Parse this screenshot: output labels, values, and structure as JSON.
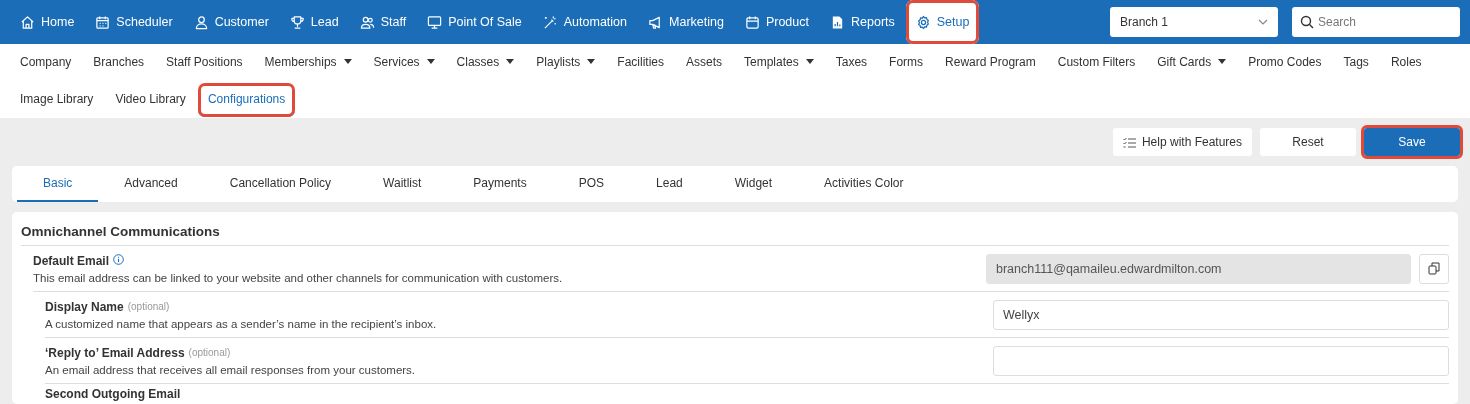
{
  "top_nav": [
    {
      "label": "Home",
      "selected": false,
      "highlighted": false
    },
    {
      "label": "Scheduler",
      "selected": false,
      "highlighted": false
    },
    {
      "label": "Customer",
      "selected": false,
      "highlighted": false
    },
    {
      "label": "Lead",
      "selected": false,
      "highlighted": false
    },
    {
      "label": "Staff",
      "selected": false,
      "highlighted": false
    },
    {
      "label": "Point Of Sale",
      "selected": false,
      "highlighted": false
    },
    {
      "label": "Automation",
      "selected": false,
      "highlighted": false
    },
    {
      "label": "Marketing",
      "selected": false,
      "highlighted": false
    },
    {
      "label": "Product",
      "selected": false,
      "highlighted": false
    },
    {
      "label": "Reports",
      "selected": false,
      "highlighted": false
    },
    {
      "label": "Setup",
      "selected": true,
      "highlighted": true
    }
  ],
  "branch_select": {
    "value": "Branch 1"
  },
  "search": {
    "placeholder": "Search"
  },
  "sub_nav": [
    [
      {
        "label": "Company",
        "dropdown": false,
        "selected": false,
        "highlighted": false
      },
      {
        "label": "Branches",
        "dropdown": false,
        "selected": false,
        "highlighted": false
      },
      {
        "label": "Staff Positions",
        "dropdown": false,
        "selected": false,
        "highlighted": false
      },
      {
        "label": "Memberships",
        "dropdown": true,
        "selected": false,
        "highlighted": false
      },
      {
        "label": "Services",
        "dropdown": true,
        "selected": false,
        "highlighted": false
      },
      {
        "label": "Classes",
        "dropdown": true,
        "selected": false,
        "highlighted": false
      },
      {
        "label": "Playlists",
        "dropdown": true,
        "selected": false,
        "highlighted": false
      },
      {
        "label": "Facilities",
        "dropdown": false,
        "selected": false,
        "highlighted": false
      },
      {
        "label": "Assets",
        "dropdown": false,
        "selected": false,
        "highlighted": false
      },
      {
        "label": "Templates",
        "dropdown": true,
        "selected": false,
        "highlighted": false
      },
      {
        "label": "Taxes",
        "dropdown": false,
        "selected": false,
        "highlighted": false
      },
      {
        "label": "Forms",
        "dropdown": false,
        "selected": false,
        "highlighted": false
      },
      {
        "label": "Reward Program",
        "dropdown": false,
        "selected": false,
        "highlighted": false
      },
      {
        "label": "Custom Filters",
        "dropdown": false,
        "selected": false,
        "highlighted": false
      },
      {
        "label": "Gift Cards",
        "dropdown": true,
        "selected": false,
        "highlighted": false
      },
      {
        "label": "Promo Codes",
        "dropdown": false,
        "selected": false,
        "highlighted": false
      },
      {
        "label": "Tags",
        "dropdown": false,
        "selected": false,
        "highlighted": false
      },
      {
        "label": "Roles",
        "dropdown": false,
        "selected": false,
        "highlighted": false
      }
    ],
    [
      {
        "label": "Image Library",
        "dropdown": false,
        "selected": false,
        "highlighted": false
      },
      {
        "label": "Video Library",
        "dropdown": false,
        "selected": false,
        "highlighted": false
      },
      {
        "label": "Configurations",
        "dropdown": false,
        "selected": true,
        "highlighted": true
      }
    ]
  ],
  "actions": [
    {
      "label": "Help with Features",
      "kind": "help",
      "highlighted": false
    },
    {
      "label": "Reset",
      "kind": "plain",
      "highlighted": false
    },
    {
      "label": "Save",
      "kind": "primary",
      "highlighted": true
    }
  ],
  "tabs": [
    {
      "label": "Basic",
      "selected": true
    },
    {
      "label": "Advanced",
      "selected": false
    },
    {
      "label": "Cancellation Policy",
      "selected": false
    },
    {
      "label": "Waitlist",
      "selected": false
    },
    {
      "label": "Payments",
      "selected": false
    },
    {
      "label": "POS",
      "selected": false
    },
    {
      "label": "Lead",
      "selected": false
    },
    {
      "label": "Widget",
      "selected": false
    },
    {
      "label": "Activities Color",
      "selected": false
    }
  ],
  "section": {
    "title": "Omnichannel Communications",
    "fields": [
      {
        "label": "Default Email",
        "info": true,
        "description": "This email address can be linked to your website and other channels for communication with customers.",
        "value": "branch111@qamaileu.edwardmilton.com",
        "disabled": true,
        "copy": true,
        "children": [
          {
            "label": "Display Name",
            "note": "(optional)",
            "description": "A customized name that appears as a sender’s name in the recipient’s inbox.",
            "value": "Wellyx",
            "disabled": false,
            "copy": false
          },
          {
            "label": "‘Reply to’ Email Address",
            "note": "(optional)",
            "description": "An email address that receives all email responses from your customers.",
            "disabled": false,
            "copy": false
          },
          {
            "label": "Second Outgoing Email"
          }
        ]
      }
    ]
  }
}
